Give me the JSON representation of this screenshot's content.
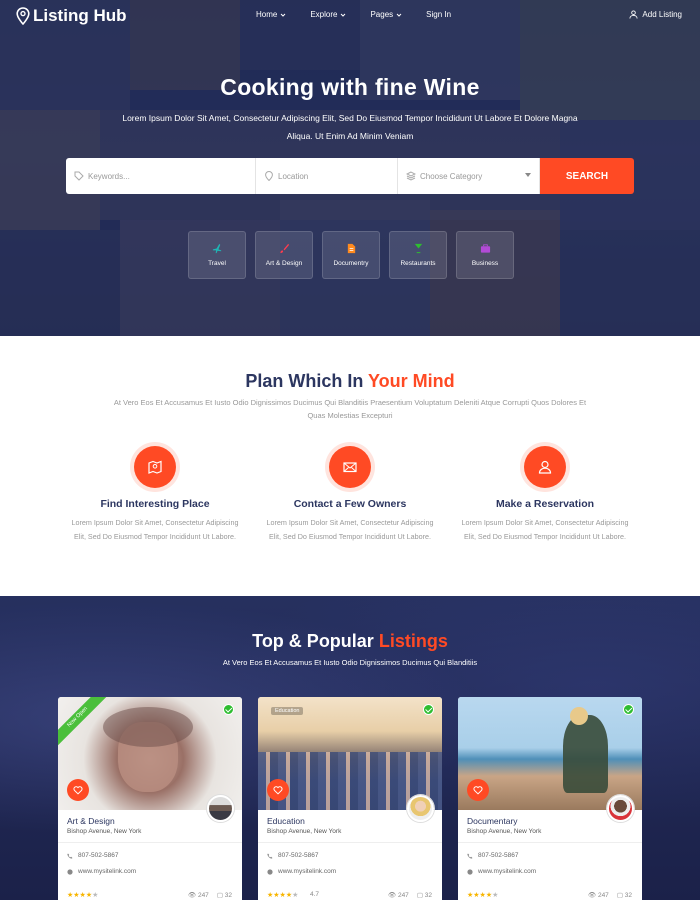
{
  "brand": {
    "name": "Listing Hub"
  },
  "nav": {
    "items": [
      {
        "label": "Home",
        "has_dropdown": true
      },
      {
        "label": "Explore",
        "has_dropdown": true
      },
      {
        "label": "Pages",
        "has_dropdown": true
      },
      {
        "label": "Sign In",
        "has_dropdown": false
      }
    ],
    "add_listing": "Add Listing"
  },
  "hero": {
    "title": "Cooking with fine Wine",
    "subtitle": "Lorem Ipsum Dolor Sit Amet, Consectetur Adipiscing Elit, Sed Do Eiusmod Tempor Incididunt Ut Labore Et Dolore Magna Aliqua. Ut Enim Ad Minim Veniam"
  },
  "search": {
    "keywords_placeholder": "Keywords...",
    "location_placeholder": "Location",
    "category_placeholder": "Choose Category",
    "button": "SEARCH"
  },
  "categories": [
    {
      "label": "Travel",
      "icon": "plane-icon",
      "color": "#1fb5b5"
    },
    {
      "label": "Art & Design",
      "icon": "brush-icon",
      "color": "#ff3b4e"
    },
    {
      "label": "Documentry",
      "icon": "document-icon",
      "color": "#ff8a1e"
    },
    {
      "label": "Restaurants",
      "icon": "glass-icon",
      "color": "#2ebd30"
    },
    {
      "label": "Business",
      "icon": "briefcase-icon",
      "color": "#b24bd6"
    }
  ],
  "plan": {
    "title_main": "Plan Which In ",
    "title_accent": "Your Mind",
    "subtitle": "At Vero Eos Et Accusamus Et Iusto Odio Dignissimos Ducimus Qui Blanditiis Praesentium Voluptatum Deleniti Atque Corrupti Quos Dolores Et Quas Molestias Excepturi",
    "features": [
      {
        "title": "Find Interesting Place",
        "text": "Lorem Ipsum Dolor Sit Amet, Consectetur Adipiscing Elit, Sed Do Eiusmod Tempor Incididunt Ut Labore.",
        "icon": "map-icon"
      },
      {
        "title": "Contact a Few Owners",
        "text": "Lorem Ipsum Dolor Sit Amet, Consectetur Adipiscing Elit, Sed Do Eiusmod Tempor Incididunt Ut Labore.",
        "icon": "envelope-icon"
      },
      {
        "title": "Make a Reservation",
        "text": "Lorem Ipsum Dolor Sit Amet, Consectetur Adipiscing Elit, Sed Do Eiusmod Tempor Incididunt Ut Labore.",
        "icon": "user-icon"
      }
    ]
  },
  "listings": {
    "title_main": "Top & Popular ",
    "title_accent": "Listings",
    "subtitle": "At Vero Eos Et Accusamus Et Iusto Odio Dignissimos Ducimus Qui Blanditiis",
    "cards": [
      {
        "category": "Art & Design",
        "address": "Bishop Avenue, New York",
        "phone": "807-502-5867",
        "website": "www.mysitelink.com",
        "rating_stars": 3.5,
        "views": "247",
        "comments": "32",
        "ribbon": "Now Open",
        "tag": ""
      },
      {
        "category": "Education",
        "address": "Bishop Avenue, New York",
        "phone": "807-502-5867",
        "website": "www.mysitelink.com",
        "rating_stars": 3.5,
        "rating_text": "4.7",
        "views": "247",
        "comments": "32",
        "ribbon": "",
        "tag": "Education"
      },
      {
        "category": "Documentary",
        "address": "Bishop Avenue, New York",
        "phone": "807-502-5867",
        "website": "www.mysitelink.com",
        "rating_stars": 3.5,
        "views": "247",
        "comments": "32",
        "ribbon": "",
        "tag": ""
      }
    ]
  },
  "colors": {
    "accent": "#ff4a24",
    "navy": "#2c3660",
    "hero_bg": "#2a3566",
    "verified": "#2ebd30"
  }
}
